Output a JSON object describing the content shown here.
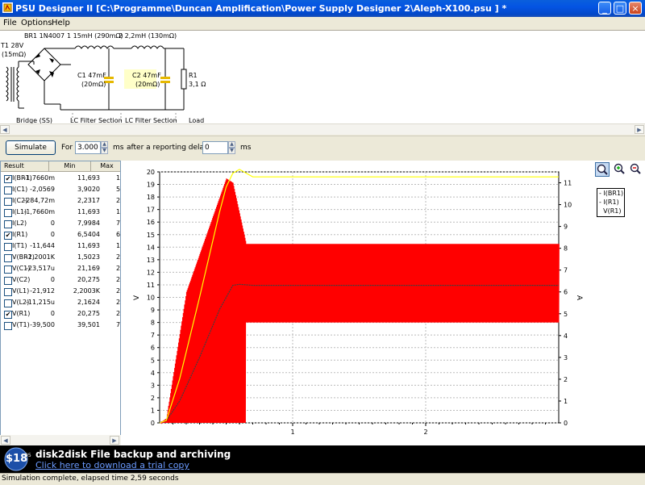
{
  "window": {
    "title": "PSU Designer II  [C:\\Programme\\Duncan Amplification\\Power Supply Designer  2\\Aleph-X100.psu ] *",
    "minimize": "_",
    "maximize": "□",
    "close": "×"
  },
  "menu": [
    "File",
    "Options",
    "Help"
  ],
  "schematic": {
    "t1": "T1 28V",
    "t1_res": "(15mΩ)",
    "br1": "BR1 1N4007",
    "l1": "1 15mH (290mΩ)",
    "l2": "2 2,2mH (130mΩ)",
    "c1": "C1 47mF",
    "c1_res": "(20mΩ)",
    "c2": "C2 47mF",
    "c2_res": "(20mΩ)",
    "r1": "R1",
    "r1_val": "3,1 Ω",
    "labels": [
      "Bridge (SS)",
      "LC Filter Section",
      "LC Filter Section",
      "Load"
    ]
  },
  "controls": {
    "simulate": "Simulate",
    "for_label": "For",
    "duration": "3.000",
    "ms1": "ms",
    "delay_label": "after a reporting delay of",
    "delay": "0",
    "ms2": "ms"
  },
  "table": {
    "headers": [
      "Result",
      "Min",
      "Max"
    ],
    "rows": [
      {
        "checked": true,
        "name": "I(BR1)",
        "min": "-1,7660m",
        "max": "11,693",
        "extra": "1"
      },
      {
        "checked": false,
        "name": "I(C1)",
        "min": "-2,0569",
        "max": "3,9020",
        "extra": "5,"
      },
      {
        "checked": false,
        "name": "I(C2)",
        "min": "-284,72m",
        "max": "2,2317",
        "extra": "2,"
      },
      {
        "checked": false,
        "name": "I(L1)",
        "min": "-1,7660m",
        "max": "11,693",
        "extra": "1"
      },
      {
        "checked": false,
        "name": "I(L2)",
        "min": "0",
        "max": "7,9984",
        "extra": "7,"
      },
      {
        "checked": true,
        "name": "I(R1)",
        "min": "0",
        "max": "6,5404",
        "extra": "6,"
      },
      {
        "checked": false,
        "name": "I(T1)",
        "min": "-11,644",
        "max": "11,693",
        "extra": "1"
      },
      {
        "checked": false,
        "name": "V(BR1)",
        "min": "-2,2001K",
        "max": "1,5023",
        "extra": "2,2"
      },
      {
        "checked": false,
        "name": "V(C1)",
        "min": "-23,517u",
        "max": "21,169",
        "extra": "2"
      },
      {
        "checked": false,
        "name": "V(C2)",
        "min": "0",
        "max": "20,275",
        "extra": "2"
      },
      {
        "checked": false,
        "name": "V(L1)",
        "min": "-21,912",
        "max": "2,2003K",
        "extra": "2,2"
      },
      {
        "checked": false,
        "name": "V(L2)",
        "min": "-11,215u",
        "max": "2,1624",
        "extra": "2,"
      },
      {
        "checked": true,
        "name": "V(R1)",
        "min": "0",
        "max": "20,275",
        "extra": "2"
      },
      {
        "checked": false,
        "name": "V(T1)",
        "min": "-39,500",
        "max": "39,501",
        "extra": "7"
      }
    ]
  },
  "zoom_buttons": [
    "zoom-fit-icon",
    "zoom-in-icon",
    "zoom-out-icon"
  ],
  "chart_data": {
    "type": "line",
    "xlabel": "",
    "ylabel_left": "V",
    "ylabel_right": "A",
    "x_ticks": [
      "1",
      "2"
    ],
    "xlim": [
      0,
      3
    ],
    "ylim_left": [
      0,
      20
    ],
    "ylim_right": [
      0,
      11.5
    ],
    "yticks_left": [
      0,
      1,
      2,
      3,
      4,
      5,
      6,
      7,
      8,
      9,
      10,
      11,
      12,
      13,
      14,
      15,
      16,
      17,
      18,
      19,
      20
    ],
    "yticks_right": [
      0,
      1,
      2,
      3,
      4,
      5,
      6,
      7,
      8,
      9,
      10,
      11
    ],
    "grid": true,
    "legend": "top-right",
    "series": [
      {
        "name": "I(BR1)",
        "color": "#ff0000",
        "axis": "right",
        "description_points": {
          "x": [
            0,
            0.05,
            0.2,
            0.5,
            0.55,
            0.65,
            0.7,
            3.0
          ],
          "peak": [
            0,
            0.2,
            6.0,
            11.2,
            11.0,
            8.2,
            8.2,
            8.2
          ],
          "trough": [
            0,
            0,
            0,
            0,
            0,
            0,
            0,
            0
          ]
        },
        "ripple_period": 0.01
      },
      {
        "name": "I(R1)",
        "color": "#404040",
        "axis": "right",
        "x": [
          0,
          0.05,
          0.15,
          0.3,
          0.45,
          0.55,
          0.6,
          0.7,
          3.0
        ],
        "y": [
          0,
          0.1,
          1.0,
          3.0,
          5.2,
          6.3,
          6.35,
          6.3,
          6.3
        ]
      },
      {
        "name": "V(R1)",
        "color": "#ffff00",
        "axis": "left",
        "x": [
          0,
          0.05,
          0.15,
          0.3,
          0.45,
          0.5,
          0.55,
          0.6,
          0.7,
          3.0
        ],
        "y": [
          0,
          0.2,
          3.5,
          10.0,
          16.8,
          18.8,
          19.9,
          20.2,
          19.6,
          19.6
        ]
      }
    ]
  },
  "banner": {
    "price": "$18",
    "price_sub": "95",
    "headline": "disk2disk File backup and archiving",
    "link": "Click here to download a trial copy"
  },
  "status": "Simulation complete, elapsed time 2,59 seconds"
}
